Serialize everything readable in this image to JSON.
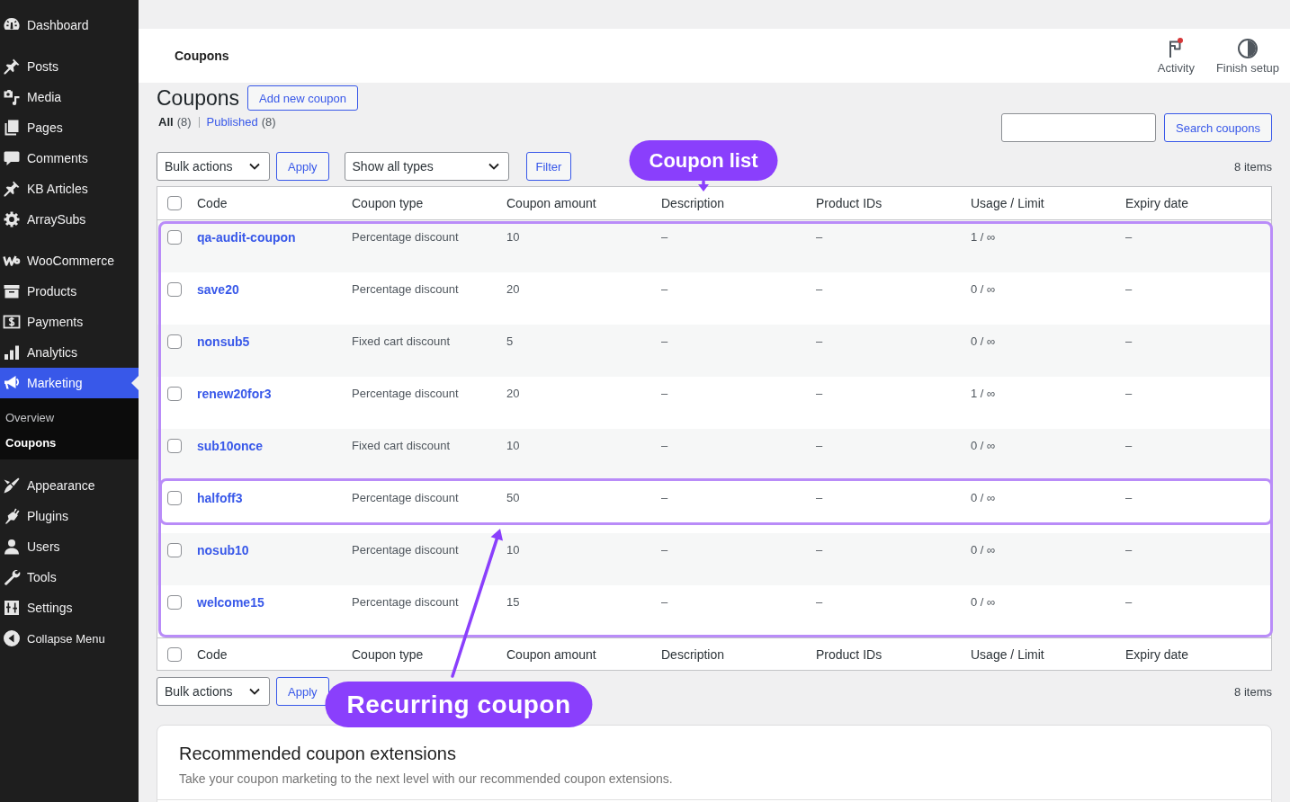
{
  "sidebar": {
    "groups": [
      {
        "items": [
          {
            "label": "Dashboard",
            "selected": false
          }
        ]
      },
      {
        "items": [
          {
            "label": "Posts",
            "selected": false
          },
          {
            "label": "Media",
            "selected": false
          },
          {
            "label": "Pages",
            "selected": false
          },
          {
            "label": "Comments",
            "selected": false
          },
          {
            "label": "KB Articles",
            "selected": false
          },
          {
            "label": "ArraySubs",
            "selected": false
          }
        ]
      },
      {
        "items": [
          {
            "label": "WooCommerce",
            "selected": false
          },
          {
            "label": "Products",
            "selected": false
          },
          {
            "label": "Payments",
            "selected": false
          },
          {
            "label": "Analytics",
            "selected": false
          },
          {
            "label": "Marketing",
            "selected": true,
            "children": [
              {
                "label": "Overview",
                "selected": false
              },
              {
                "label": "Coupons",
                "selected": true
              }
            ]
          }
        ]
      },
      {
        "items": [
          {
            "label": "Appearance",
            "selected": false
          },
          {
            "label": "Plugins",
            "selected": false
          },
          {
            "label": "Users",
            "selected": false
          },
          {
            "label": "Tools",
            "selected": false
          },
          {
            "label": "Settings",
            "selected": false
          }
        ]
      }
    ],
    "collapse_button": "Collapse Menu"
  },
  "header": {
    "title": "Coupons",
    "actions": [
      {
        "label": "Activity",
        "has_notification": true
      },
      {
        "label": "Finish setup",
        "has_notification": false
      }
    ]
  },
  "page": {
    "heading": "Coupons",
    "add_button": "Add new coupon",
    "views": [
      {
        "label": "All",
        "count": "(8)",
        "selected": true
      },
      {
        "label": "Published",
        "count": "(8)",
        "selected": false
      }
    ],
    "search_button": "Search coupons"
  },
  "top_nav": {
    "bulk_action": "Bulk actions",
    "apply": "Apply",
    "type_filter": "Show all types",
    "filter": "Filter",
    "count": "8 items"
  },
  "table": {
    "select_all_checked": false,
    "columns": [
      "Code",
      "Coupon type",
      "Coupon amount",
      "Description",
      "Product IDs",
      "Usage / Limit",
      "Expiry date"
    ],
    "rows": [
      {
        "code": "qa-audit-coupon",
        "coupon_type": "Percentage discount",
        "coupon_amount": "10",
        "description": "–",
        "product_ids": "–",
        "usage_limit": "1 / ∞",
        "expiry_date": "–",
        "checked": false,
        "highlighted": false
      },
      {
        "code": "save20",
        "coupon_type": "Percentage discount",
        "coupon_amount": "20",
        "description": "–",
        "product_ids": "–",
        "usage_limit": "0 / ∞",
        "expiry_date": "–",
        "checked": false,
        "highlighted": false
      },
      {
        "code": "nonsub5",
        "coupon_type": "Fixed cart discount",
        "coupon_amount": "5",
        "description": "–",
        "product_ids": "–",
        "usage_limit": "0 / ∞",
        "expiry_date": "–",
        "checked": false,
        "highlighted": false
      },
      {
        "code": "renew20for3",
        "coupon_type": "Percentage discount",
        "coupon_amount": "20",
        "description": "–",
        "product_ids": "–",
        "usage_limit": "1 / ∞",
        "expiry_date": "–",
        "checked": false,
        "highlighted": false
      },
      {
        "code": "sub10once",
        "coupon_type": "Fixed cart discount",
        "coupon_amount": "10",
        "description": "–",
        "product_ids": "–",
        "usage_limit": "0 / ∞",
        "expiry_date": "–",
        "checked": false,
        "highlighted": false
      },
      {
        "code": "halfoff3",
        "coupon_type": "Percentage discount",
        "coupon_amount": "50",
        "description": "–",
        "product_ids": "–",
        "usage_limit": "0 / ∞",
        "expiry_date": "–",
        "checked": false,
        "highlighted": true
      },
      {
        "code": "nosub10",
        "coupon_type": "Percentage discount",
        "coupon_amount": "10",
        "description": "–",
        "product_ids": "–",
        "usage_limit": "0 / ∞",
        "expiry_date": "–",
        "checked": false,
        "highlighted": false
      },
      {
        "code": "welcome15",
        "coupon_type": "Percentage discount",
        "coupon_amount": "15",
        "description": "–",
        "product_ids": "–",
        "usage_limit": "0 / ∞",
        "expiry_date": "–",
        "checked": false,
        "highlighted": false
      }
    ],
    "footer_select_all_checked": false,
    "footer_columns": [
      "Code",
      "Coupon type",
      "Coupon amount",
      "Description",
      "Product IDs",
      "Usage / Limit",
      "Expiry date"
    ]
  },
  "bottom_nav": {
    "bulk_action": "Bulk actions",
    "apply": "Apply",
    "count": "8 items"
  },
  "card": {
    "title": "Recommended coupon extensions",
    "description": "Take your coupon marketing to the next level with our recommended coupon extensions."
  },
  "annotations": [
    {
      "kind": "list",
      "text": "Coupon list"
    },
    {
      "kind": "row",
      "text": "Recurring coupon"
    }
  ]
}
